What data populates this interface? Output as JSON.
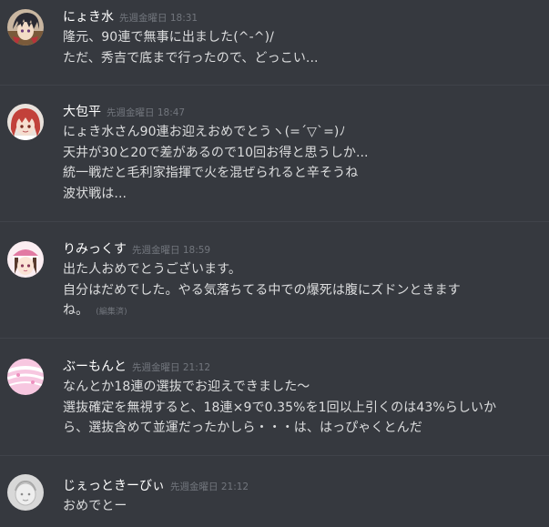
{
  "messages": [
    {
      "username": "にょき水",
      "timestamp": "先週金曜日 18:31",
      "lines": [
        "隆元、90連で無事に出ました(^-^)/",
        "ただ、秀吉で底まで行ったので、どっこい..."
      ],
      "avatar": "anime-avatar-dark-hair-icon"
    },
    {
      "username": "大包平",
      "timestamp": "先週金曜日 18:47",
      "lines": [
        "にょき水さん90連お迎えおめでとうヽ(=´▽`=)ﾉ",
        "天井が30と20で差があるので10回お得と思うしか...",
        "統一戦だと毛利家指揮で火を混ぜられると辛そうね",
        "波状戦は..."
      ],
      "avatar": "anime-avatar-red-hair-icon"
    },
    {
      "username": "りみっくす",
      "timestamp": "先週金曜日 18:59",
      "lines": [
        "出た人おめでとうございます。",
        "自分はだめでした。やる気落ちてる中での爆死は腹にズドンときます",
        "ね。"
      ],
      "edited": "(編集済)",
      "avatar": "anime-avatar-pink-hat-icon"
    },
    {
      "username": "ぶーもんと",
      "timestamp": "先週金曜日 21:12",
      "lines": [
        "なんとか18連の選抜でお迎えできました〜",
        "選抜確定を無視すると、18連×9で0.35%を1回以上引くのは43%らしいか",
        "ら、選抜含めて並運だったかしら・・・は、はっぴゃくとんだ"
      ],
      "avatar": "pink-ribbon-avatar-icon"
    },
    {
      "username": "じぇっときーびぃ",
      "timestamp": "先週金曜日 21:12",
      "lines": [
        "おめでとー"
      ],
      "avatar": "gray-sketch-avatar-icon"
    }
  ]
}
